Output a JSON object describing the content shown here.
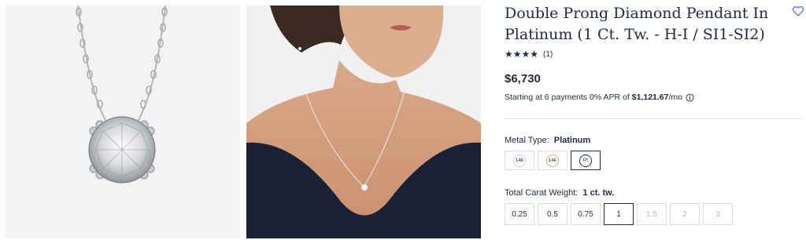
{
  "product": {
    "title": "Double Prong Diamond Pendant In Platinum (1 Ct. Tw. - H-I / SI1-SI2)",
    "rating_stars": "★★★★",
    "review_count": "(1)",
    "price": "$6,730",
    "financing_prefix": "Starting at 6 payments 0% APR of",
    "financing_amount": "$1,121.67",
    "financing_suffix": "/mo"
  },
  "metal": {
    "label": "Metal Type:",
    "selected": "Platinum",
    "options": [
      {
        "text": "14k",
        "kind": "white-gold"
      },
      {
        "text": "14k",
        "kind": "rose-gold"
      },
      {
        "text": "Pt",
        "kind": "platinum"
      }
    ]
  },
  "carat": {
    "label": "Total Carat Weight:",
    "selected": "1 ct. tw.",
    "options": [
      "0.25",
      "0.5",
      "0.75",
      "1",
      "1.5",
      "2",
      "3"
    ]
  },
  "icons": {
    "wishlist": "heart-icon",
    "info": "info-icon"
  },
  "colors": {
    "navy": "#1f2a44",
    "rose_gold": "#e3a57f",
    "border": "#dcdcdc",
    "disabled_text": "#b5b8c2"
  }
}
